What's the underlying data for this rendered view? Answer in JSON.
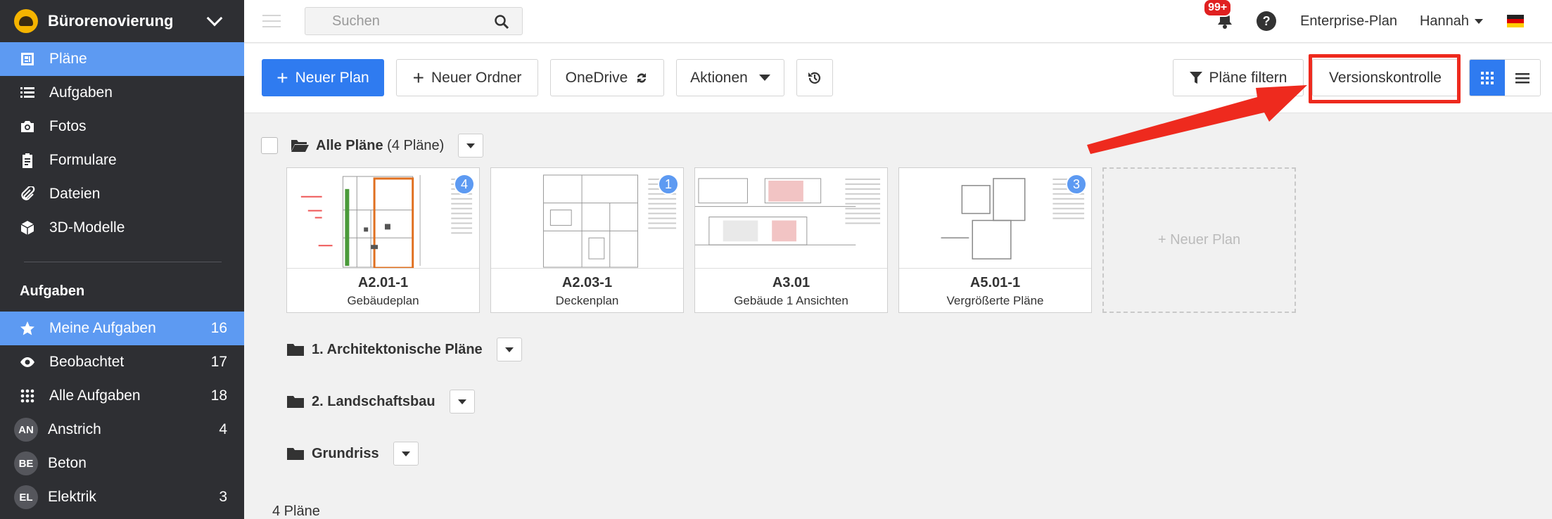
{
  "sidebar": {
    "project_name": "Bürorenovierung",
    "nav": [
      {
        "label": "Pläne",
        "icon": "plans-icon",
        "active": true
      },
      {
        "label": "Aufgaben",
        "icon": "list-icon"
      },
      {
        "label": "Fotos",
        "icon": "camera-icon"
      },
      {
        "label": "Formulare",
        "icon": "clipboard-icon"
      },
      {
        "label": "Dateien",
        "icon": "paperclip-icon"
      },
      {
        "label": "3D-Modelle",
        "icon": "cube-icon"
      }
    ],
    "tasks_heading": "Aufgaben",
    "tasks": [
      {
        "label": "Meine Aufgaben",
        "count": "16",
        "icon": "star-icon",
        "active": true
      },
      {
        "label": "Beobachtet",
        "count": "17",
        "icon": "eye-icon"
      },
      {
        "label": "Alle Aufgaben",
        "count": "18",
        "icon": "grid-icon"
      },
      {
        "label": "Anstrich",
        "count": "4",
        "avatar": "AN"
      },
      {
        "label": "Beton",
        "count": "",
        "avatar": "BE"
      },
      {
        "label": "Elektrik",
        "count": "3",
        "avatar": "EL"
      }
    ]
  },
  "topbar": {
    "search_placeholder": "Suchen",
    "notification_badge": "99+",
    "help": "?",
    "plan": "Enterprise-Plan",
    "user": "Hannah"
  },
  "toolbar": {
    "new_plan": "Neuer Plan",
    "new_folder": "Neuer Ordner",
    "onedrive": "OneDrive",
    "actions": "Aktionen",
    "filter": "Pläne filtern",
    "version_control": "Versionskontrolle",
    "accent_color": "#2f7bf0",
    "highlight_color": "#ee2a1e"
  },
  "main": {
    "all_plans_label": "Alle Pläne",
    "all_plans_count": "(4 Pläne)",
    "plans": [
      {
        "name": "A2.01-1",
        "subtitle": "Gebäudeplan",
        "versions": "4"
      },
      {
        "name": "A2.03-1",
        "subtitle": "Deckenplan",
        "versions": "1"
      },
      {
        "name": "A3.01",
        "subtitle": "Gebäude 1 Ansichten",
        "versions": ""
      },
      {
        "name": "A5.01-1",
        "subtitle": "Vergrößerte Pläne",
        "versions": "3"
      }
    ],
    "new_plan_card": "+ Neuer Plan",
    "folders": [
      "1. Architektonische Pläne",
      "2. Landschaftsbau",
      "Grundriss"
    ],
    "footer": "4 Pläne"
  }
}
